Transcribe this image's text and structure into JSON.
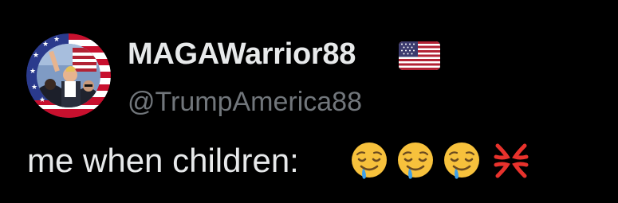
{
  "post": {
    "author": {
      "display_name": "MAGAWarrior88",
      "flag_emoji": "🇺🇸",
      "handle": "@TrumpAmerica88",
      "avatar": "profile-photo-with-american-flag-border"
    },
    "text": "me when children:",
    "emojis": [
      "🤤",
      "🤤",
      "🤤",
      "💢"
    ],
    "emoji_names": [
      "drooling-face-icon",
      "drooling-face-icon",
      "drooling-face-icon",
      "anger-symbol-icon"
    ]
  },
  "colors": {
    "background": "#000000",
    "primary_text": "#e7e9ea",
    "secondary_text": "#71767b",
    "flag_red": "#b22234",
    "flag_blue": "#3c3b6e"
  }
}
